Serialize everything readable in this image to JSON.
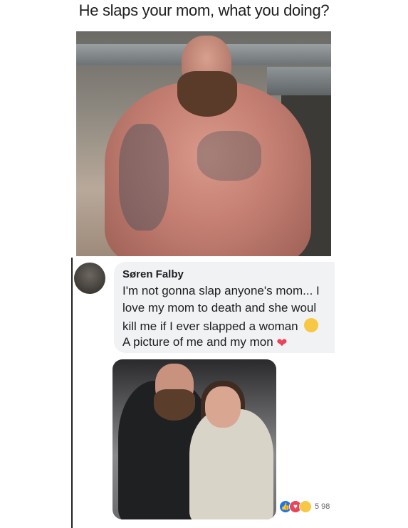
{
  "meme": {
    "caption": "He slaps your mom, what you doing?"
  },
  "comment": {
    "author": "Søren Falby",
    "lines": [
      "I'm not gonna slap anyone's mom... I",
      "love my mom to death and she woul",
      "kill me if I ever slapped a woman",
      "A picture of me and my mon"
    ],
    "icons": {
      "line3_end": "laughing-emoji-icon",
      "line4_end": "heart-icon"
    },
    "reactions": {
      "icons": [
        "like-icon",
        "love-icon",
        "haha-icon"
      ],
      "count": "5 98"
    }
  },
  "colors": {
    "bubble_bg": "#f1f2f4",
    "like_blue": "#1877f2",
    "love_red": "#e8445a",
    "haha_yellow": "#f7c844"
  }
}
